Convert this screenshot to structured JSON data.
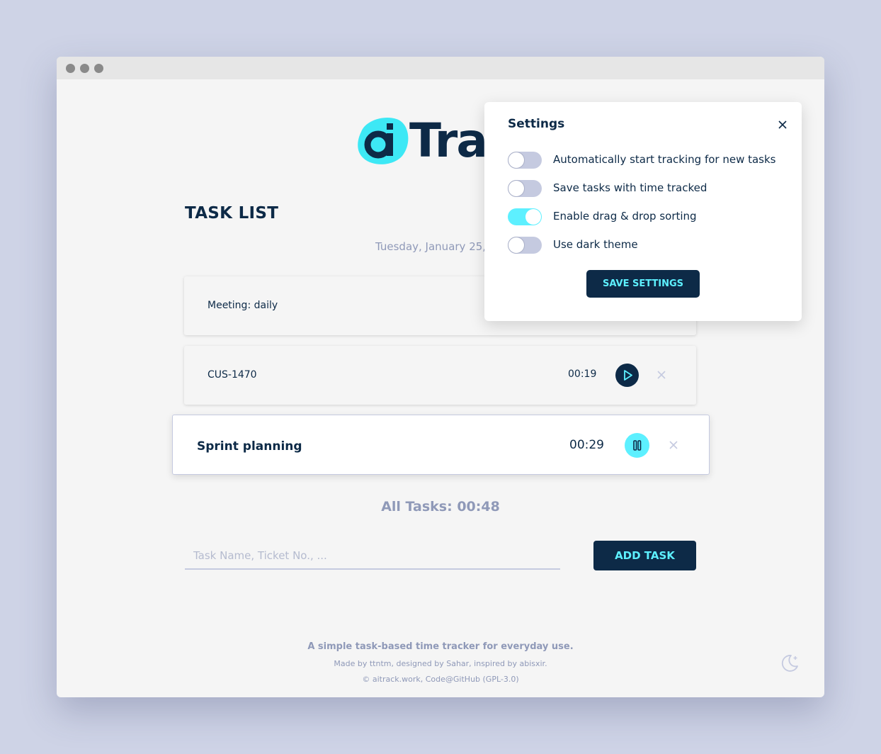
{
  "app": {
    "logo_text": "Trac",
    "heading": "TASK LIST",
    "date": "Tuesday, January 25, 2"
  },
  "tasks": [
    {
      "name": "Meeting: daily",
      "time": ""
    },
    {
      "name": "CUS-1470",
      "time": "00:19",
      "state": "paused"
    },
    {
      "name": "Sprint planning",
      "time": "00:29",
      "state": "running"
    }
  ],
  "summary": {
    "all_tasks": "All Tasks: 00:48"
  },
  "new_task": {
    "placeholder": "Task Name, Ticket No., ...",
    "add_label": "ADD TASK"
  },
  "footer": {
    "tagline": "A simple task-based time tracker for everyday use.",
    "credits": "Made by ttntm, designed by Sahar, inspired by abisxir.",
    "copyright": "© aitrack.work, Code@GitHub (GPL-3.0)"
  },
  "settings": {
    "title": "Settings",
    "options": [
      {
        "label": "Automatically start tracking for new tasks",
        "enabled": false
      },
      {
        "label": "Save tasks with time tracked",
        "enabled": false
      },
      {
        "label": "Enable drag & drop sorting",
        "enabled": true
      },
      {
        "label": "Use dark theme",
        "enabled": false
      }
    ],
    "save_label": "SAVE SETTINGS"
  },
  "colors": {
    "background": "#ced3e6",
    "navy": "#0d2a47",
    "accent": "#5df0ff",
    "muted": "#8f99b8"
  }
}
